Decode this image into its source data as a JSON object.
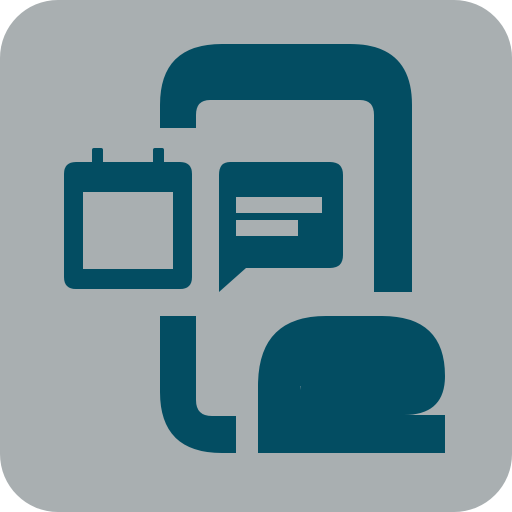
{
  "icon": {
    "background_color": "#a9afb1",
    "foreground_color": "#034d62",
    "glyphs": [
      "phone-outline-icon",
      "calendar-icon",
      "chat-bubble-icon",
      "le-letters-logo"
    ]
  }
}
